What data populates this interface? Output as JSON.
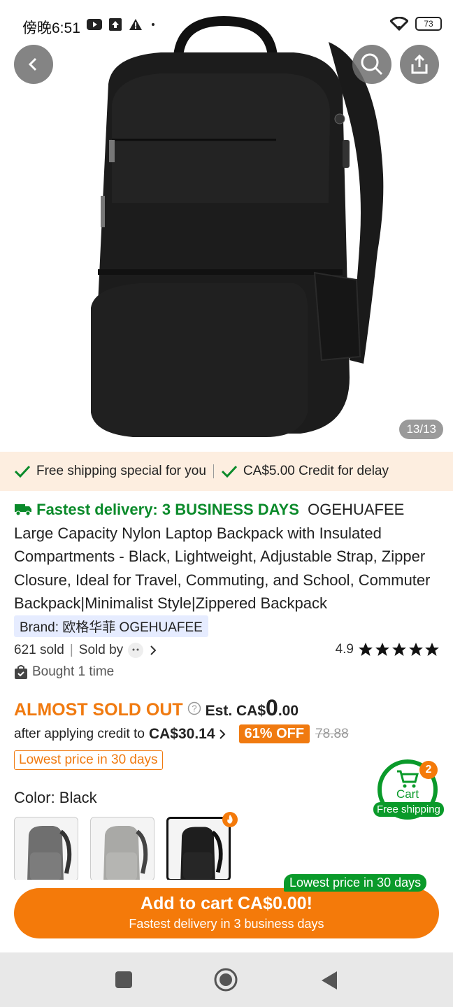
{
  "status_bar": {
    "time": "傍晚6:51",
    "battery": "73"
  },
  "hero": {
    "counter": "13/13"
  },
  "shipping_bar": {
    "free_shipping": "Free shipping special for you",
    "credit": "CA$5.00 Credit for delay"
  },
  "product": {
    "delivery_prefix": "Fastest delivery: 3 BUSINESS DAYS",
    "title": "OGEHUAFEE Large Capacity Nylon Laptop Backpack with Insulated Compartments - Black, Lightweight, Adjustable Strap, Zipper Closure, Ideal for Travel, Commuting, and School, Commuter Backpack|Minimalist Style|Zippered Backpack",
    "brand": "Brand: 欧格华菲 OGEHUAFEE",
    "sold": "621 sold",
    "sold_by": "Sold by",
    "rating": "4.9",
    "bought": "Bought 1 time"
  },
  "price": {
    "almost_sold_out": "ALMOST SOLD OUT",
    "est_prefix": "Est. CA$",
    "est_int": "0",
    "est_dec": ".00",
    "after_credit": "after applying credit to",
    "after_credit_price": "CA$30.14",
    "discount": "61% OFF",
    "original": "78.88",
    "lowest_tag": "Lowest price in 30 days"
  },
  "color": {
    "label": "Color: Black"
  },
  "cart_float": {
    "label": "Cart",
    "count": "2",
    "free_shipping": "Free shipping"
  },
  "bottom": {
    "lowest_tag": "Lowest price in 30 days",
    "add_to_cart": "Add to cart CA$0.00!",
    "sub": "Fastest delivery in 3 business days"
  },
  "colors": {
    "accent": "#f47a0a",
    "green": "#0a8a2a"
  }
}
